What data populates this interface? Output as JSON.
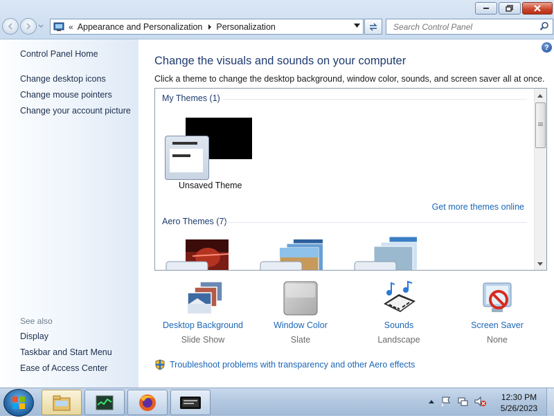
{
  "address": {
    "crumbs": [
      "Appearance and Personalization",
      "Personalization"
    ]
  },
  "search": {
    "placeholder": "Search Control Panel"
  },
  "left_pane": {
    "home": "Control Panel Home",
    "links": [
      "Change desktop icons",
      "Change mouse pointers",
      "Change your account picture"
    ],
    "see_also_label": "See also",
    "see_also": [
      "Display",
      "Taskbar and Start Menu",
      "Ease of Access Center"
    ]
  },
  "main": {
    "heading": "Change the visuals and sounds on your computer",
    "subtext": "Click a theme to change the desktop background, window color, sounds, and screen saver all at once.",
    "my_themes_label": "My Themes (1)",
    "unsaved_theme": "Unsaved Theme",
    "get_more_link": "Get more themes online",
    "aero_themes_label": "Aero Themes (7)"
  },
  "settings": [
    {
      "label": "Desktop Background",
      "value": "Slide Show",
      "icon": "desktop-background-icon"
    },
    {
      "label": "Window Color",
      "value": "Slate",
      "icon": "window-color-icon"
    },
    {
      "label": "Sounds",
      "value": "Landscape",
      "icon": "sounds-icon"
    },
    {
      "label": "Screen Saver",
      "value": "None",
      "icon": "screen-saver-icon"
    }
  ],
  "troubleshoot_link": "Troubleshoot problems with transparency and other Aero effects",
  "taskbar": {
    "time": "12:30 PM",
    "date": "5/26/2023"
  },
  "colors": {
    "link": "#1b66b6",
    "heading": "#1e3a6f",
    "left_pane": "#e6eef8"
  }
}
